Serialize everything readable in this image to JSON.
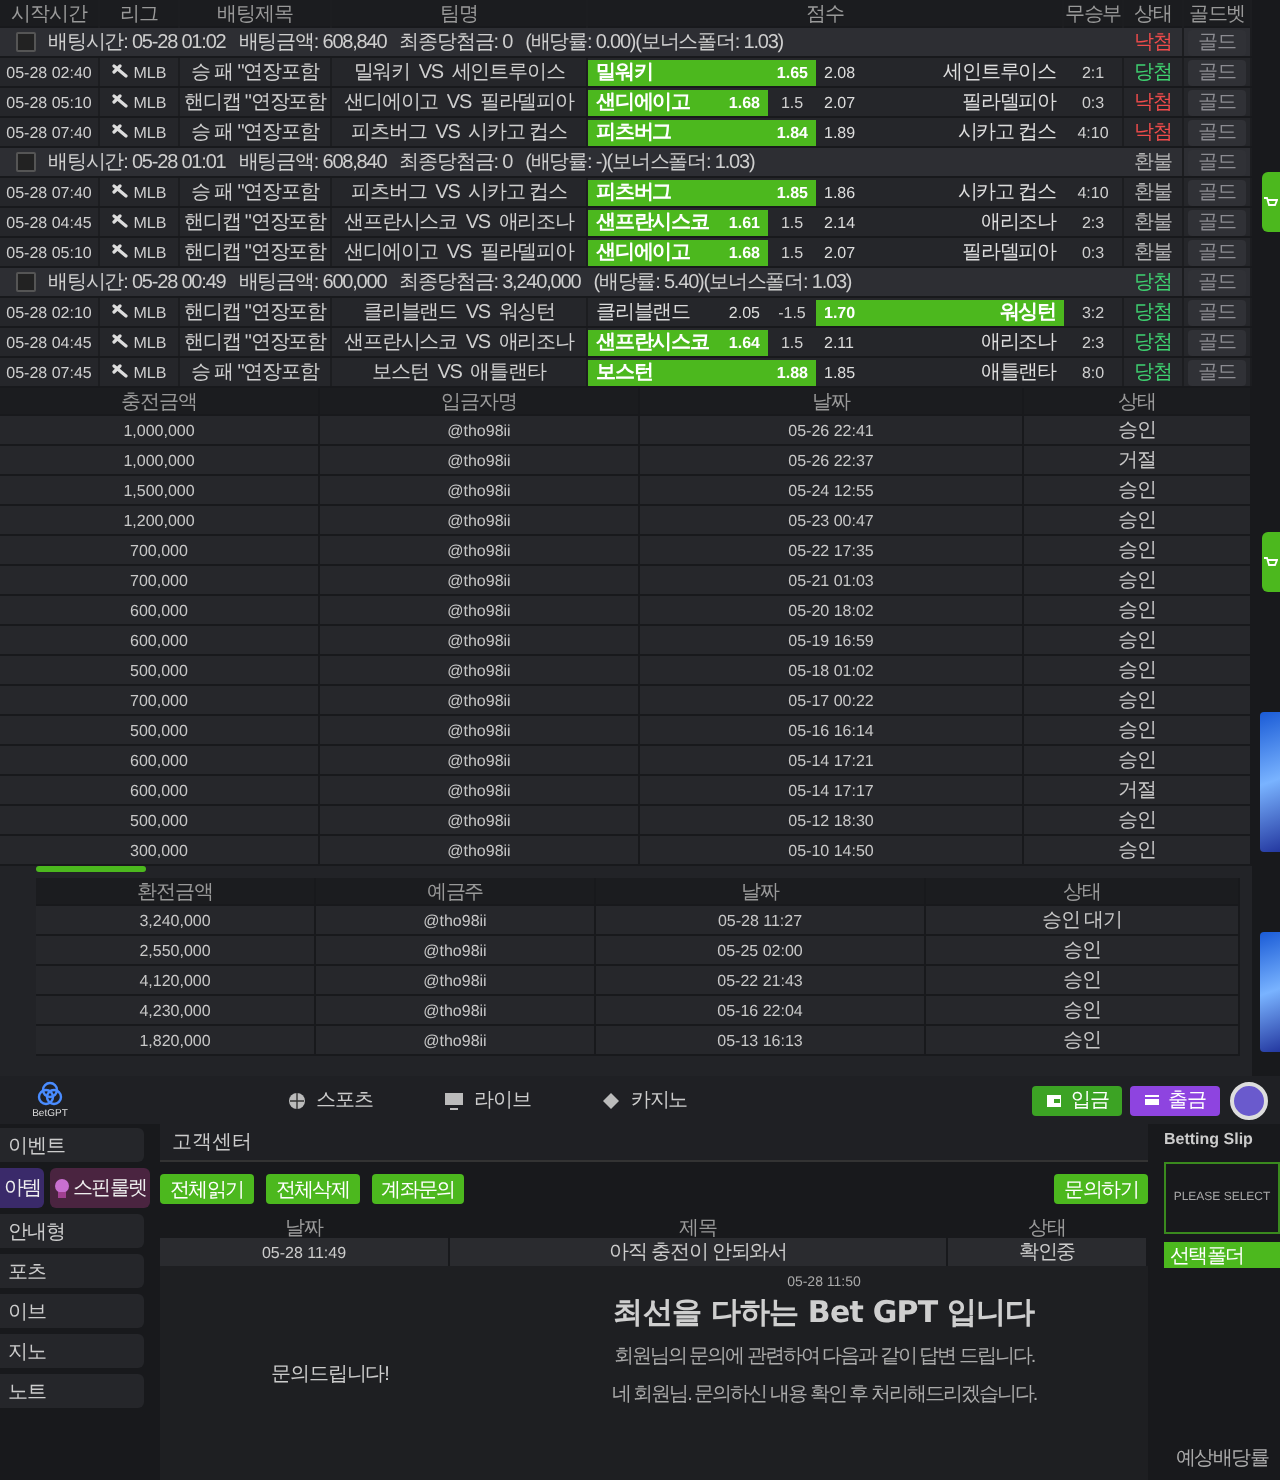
{
  "bet_history": {
    "columns": [
      "시작시간",
      "리그",
      "배팅제목",
      "팀명",
      "점수",
      "무승부",
      "상태",
      "골드벳"
    ],
    "groups": [
      {
        "checked": false,
        "summary": "배팅시간: 05-28 01:02   배팅금액: 608,840   최종당첨금: 0   (배당률: 0.00)(보너스폴더: 1.03)",
        "result": {
          "text": "낙첨",
          "color": "#ef4b4b"
        },
        "gold": {
          "label": "골드",
          "disabled": true
        },
        "rows": [
          {
            "time": "05-28 02:40",
            "league": "MLB",
            "market": "승 패 \"연장포함",
            "match": "밀워키  VS  세인트루이스",
            "kind": "moneyline",
            "home": {
              "name": "밀워키",
              "odds": "1.65",
              "selected": true
            },
            "away": {
              "name": "세인트루이스",
              "odds": "2.08",
              "selected": false
            },
            "score": "2:1",
            "result": {
              "text": "당첨",
              "color": "#3fd070"
            },
            "gold": {
              "label": "골드",
              "disabled": true
            }
          },
          {
            "time": "05-28 05:10",
            "league": "MLB",
            "market": "핸디캡 \"연장포함",
            "match": "샌디에이고  VS  필라델피아",
            "kind": "handicap",
            "home": {
              "name": "샌디에이고",
              "odds": "1.68",
              "selected": true
            },
            "line": "1.5",
            "away": {
              "name": "필라델피아",
              "odds": "2.07",
              "selected": false
            },
            "score": "0:3",
            "result": {
              "text": "낙첨",
              "color": "#ef4b4b"
            },
            "gold": {
              "label": "골드",
              "disabled": true
            }
          },
          {
            "time": "05-28 07:40",
            "league": "MLB",
            "market": "승 패 \"연장포함",
            "match": "피츠버그  VS  시카고 컵스",
            "kind": "moneyline",
            "home": {
              "name": "피츠버그",
              "odds": "1.84",
              "selected": true
            },
            "away": {
              "name": "시카고 컵스",
              "odds": "1.89",
              "selected": false
            },
            "score": "4:10",
            "result": {
              "text": "낙첨",
              "color": "#ef4b4b"
            },
            "gold": {
              "label": "골드",
              "disabled": true
            }
          }
        ]
      },
      {
        "checked": false,
        "summary": "배팅시간: 05-28 01:01   배팅금액: 608,840   최종당첨금: 0   (배당률: -)(보너스폴더: 1.03)",
        "result": {
          "text": "환불",
          "color": "#b5b5b5"
        },
        "gold": {
          "label": "골드",
          "disabled": true
        },
        "rows": [
          {
            "time": "05-28 07:40",
            "league": "MLB",
            "market": "승 패 \"연장포함",
            "match": "피츠버그  VS  시카고 컵스",
            "kind": "moneyline",
            "home": {
              "name": "피츠버그",
              "odds": "1.85",
              "selected": true
            },
            "away": {
              "name": "시카고 컵스",
              "odds": "1.86",
              "selected": false
            },
            "score": "4:10",
            "result": {
              "text": "환불",
              "color": "#b5b5b5"
            },
            "gold": {
              "label": "골드",
              "disabled": true
            }
          },
          {
            "time": "05-28 04:45",
            "league": "MLB",
            "market": "핸디캡 \"연장포함",
            "match": "샌프란시스코  VS  애리조나",
            "kind": "handicap",
            "home": {
              "name": "샌프란시스코",
              "odds": "1.61",
              "selected": true
            },
            "line": "1.5",
            "away": {
              "name": "애리조나",
              "odds": "2.14",
              "selected": false
            },
            "score": "2:3",
            "result": {
              "text": "환불",
              "color": "#b5b5b5"
            },
            "gold": {
              "label": "골드",
              "disabled": true
            }
          },
          {
            "time": "05-28 05:10",
            "league": "MLB",
            "market": "핸디캡 \"연장포함",
            "match": "샌디에이고  VS  필라델피아",
            "kind": "handicap",
            "home": {
              "name": "샌디에이고",
              "odds": "1.68",
              "selected": true
            },
            "line": "1.5",
            "away": {
              "name": "필라델피아",
              "odds": "2.07",
              "selected": false
            },
            "score": "0:3",
            "result": {
              "text": "환불",
              "color": "#b5b5b5"
            },
            "gold": {
              "label": "골드",
              "disabled": true
            }
          }
        ]
      },
      {
        "checked": false,
        "summary": "배팅시간: 05-28 00:49   배팅금액: 600,000   최종당첨금: 3,240,000   (배당률: 5.40)(보너스폴더: 1.03)",
        "result": {
          "text": "당첨",
          "color": "#3fd070"
        },
        "gold": {
          "label": "골드",
          "disabled": true
        },
        "rows": [
          {
            "time": "05-28 02:10",
            "league": "MLB",
            "market": "핸디캡 \"연장포함",
            "match": "클리블랜드  VS  워싱턴",
            "kind": "handicap",
            "home": {
              "name": "클리블랜드",
              "odds": "2.05",
              "selected": false
            },
            "line": "-1.5",
            "away": {
              "name": "워싱턴",
              "odds": "1.70",
              "selected": true
            },
            "score": "3:2",
            "result": {
              "text": "당첨",
              "color": "#3fd070"
            },
            "gold": {
              "label": "골드",
              "disabled": true
            }
          },
          {
            "time": "05-28 04:45",
            "league": "MLB",
            "market": "핸디캡 \"연장포함",
            "match": "샌프란시스코  VS  애리조나",
            "kind": "handicap",
            "home": {
              "name": "샌프란시스코",
              "odds": "1.64",
              "selected": true
            },
            "line": "1.5",
            "away": {
              "name": "애리조나",
              "odds": "2.11",
              "selected": false
            },
            "score": "2:3",
            "result": {
              "text": "당첨",
              "color": "#3fd070"
            },
            "gold": {
              "label": "골드",
              "disabled": true
            }
          },
          {
            "time": "05-28 07:45",
            "league": "MLB",
            "market": "승 패 \"연장포함",
            "match": "보스턴  VS  애틀랜타",
            "kind": "moneyline",
            "home": {
              "name": "보스턴",
              "odds": "1.88",
              "selected": true
            },
            "away": {
              "name": "애틀랜타",
              "odds": "1.85",
              "selected": false
            },
            "score": "8:0",
            "result": {
              "text": "당첨",
              "color": "#3fd070"
            },
            "gold": {
              "label": "골드",
              "disabled": true
            }
          }
        ]
      }
    ]
  },
  "deposits": {
    "columns": [
      "충전금액",
      "입금자명",
      "날짜",
      "상태"
    ],
    "rows": [
      [
        "1,000,000",
        "@tho98ii",
        "05-26 22:41",
        "승인"
      ],
      [
        "1,000,000",
        "@tho98ii",
        "05-26 22:37",
        "거절"
      ],
      [
        "1,500,000",
        "@tho98ii",
        "05-24 12:55",
        "승인"
      ],
      [
        "1,200,000",
        "@tho98ii",
        "05-23 00:47",
        "승인"
      ],
      [
        "700,000",
        "@tho98ii",
        "05-22 17:35",
        "승인"
      ],
      [
        "700,000",
        "@tho98ii",
        "05-21 01:03",
        "승인"
      ],
      [
        "600,000",
        "@tho98ii",
        "05-20 18:02",
        "승인"
      ],
      [
        "600,000",
        "@tho98ii",
        "05-19 16:59",
        "승인"
      ],
      [
        "500,000",
        "@tho98ii",
        "05-18 01:02",
        "승인"
      ],
      [
        "700,000",
        "@tho98ii",
        "05-17 00:22",
        "승인"
      ],
      [
        "500,000",
        "@tho98ii",
        "05-16 16:14",
        "승인"
      ],
      [
        "600,000",
        "@tho98ii",
        "05-14 17:21",
        "승인"
      ],
      [
        "600,000",
        "@tho98ii",
        "05-14 17:17",
        "거절"
      ],
      [
        "500,000",
        "@tho98ii",
        "05-12 18:30",
        "승인"
      ],
      [
        "300,000",
        "@tho98ii",
        "05-10 14:50",
        "승인"
      ]
    ]
  },
  "withdrawals": {
    "columns": [
      "환전금액",
      "예금주",
      "날짜",
      "상태"
    ],
    "rows": [
      [
        "3,240,000",
        "@tho98ii",
        "05-28 11:27",
        "승인 대기"
      ],
      [
        "2,550,000",
        "@tho98ii",
        "05-25 02:00",
        "승인"
      ],
      [
        "4,120,000",
        "@tho98ii",
        "05-22 21:43",
        "승인"
      ],
      [
        "4,230,000",
        "@tho98ii",
        "05-16 22:04",
        "승인"
      ],
      [
        "1,820,000",
        "@tho98ii",
        "05-13 16:13",
        "승인"
      ]
    ]
  },
  "top_nav": {
    "logo": "BetGPT",
    "items": [
      "스포츠",
      "라이브",
      "카지노"
    ],
    "deposit_button": "입금",
    "withdraw_button": "출금"
  },
  "sidebar": {
    "event": "이벤트",
    "tiles": [
      "아템",
      "스핀룰렛"
    ],
    "items": [
      "안내형",
      "포츠",
      "이브",
      "지노",
      "노트"
    ]
  },
  "support": {
    "title": "고객센터",
    "actions": [
      "전체읽기",
      "전체삭제",
      "계좌문의"
    ],
    "ask_button": "문의하기",
    "columns": [
      "날짜",
      "제목",
      "상태"
    ],
    "rows": [
      {
        "date": "05-28 11:49",
        "subject": "아직 충전이 안되와서",
        "status": "확인중",
        "expanded": true
      }
    ],
    "thread": {
      "question": "문의드립니다!",
      "answer_time": "05-28 11:50",
      "answer_title": "최선을 다하는 Bet GPT 입니다",
      "answer_lines": [
        "회원님의 문의에 관련하여 다음과 같이 답변 드립니다.",
        "네 회원님. 문의하신 내용 확인 후 처리해드리겠습니다."
      ]
    }
  },
  "betting_slip": {
    "title": "Betting Slip",
    "prompt": "PLEASE SELECT",
    "folder_label": "선택폴더",
    "odds_label": "예상배당률"
  }
}
